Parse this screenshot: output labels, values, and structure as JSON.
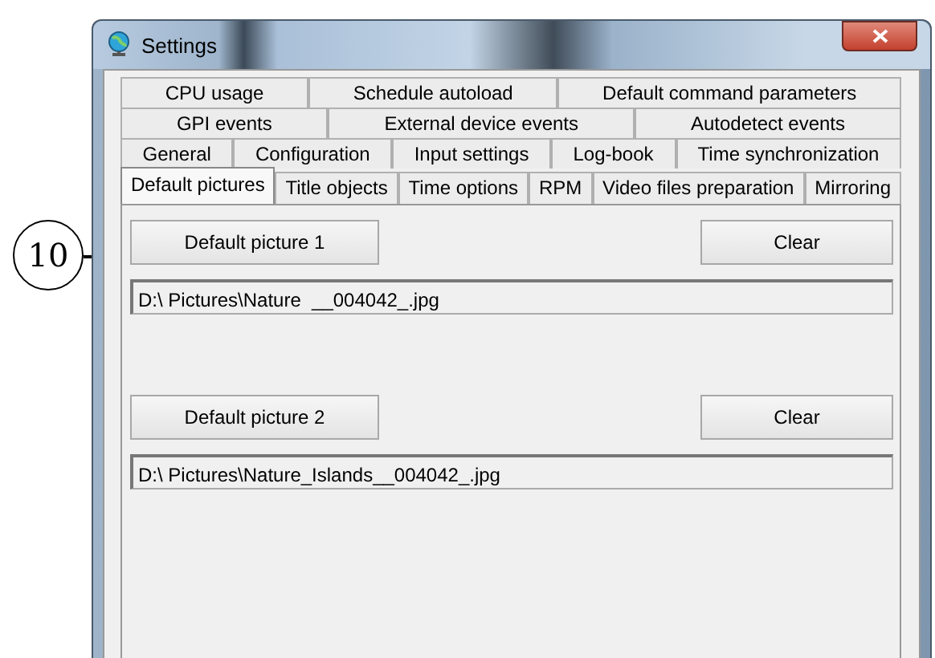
{
  "callout": {
    "label": "10"
  },
  "window": {
    "title": "Settings"
  },
  "tab_rows": [
    {
      "tabs": [
        {
          "label": "CPU usage",
          "selected": false
        },
        {
          "label": "Schedule autoload",
          "selected": false
        },
        {
          "label": "Default command parameters",
          "selected": false
        }
      ]
    },
    {
      "tabs": [
        {
          "label": "GPI events",
          "selected": false
        },
        {
          "label": "External device events",
          "selected": false
        },
        {
          "label": "Autodetect events",
          "selected": false
        }
      ]
    },
    {
      "tabs": [
        {
          "label": "General",
          "selected": false
        },
        {
          "label": "Configuration",
          "selected": false
        },
        {
          "label": "Input settings",
          "selected": false
        },
        {
          "label": "Log-book",
          "selected": false
        },
        {
          "label": "Time synchronization",
          "selected": false
        }
      ]
    },
    {
      "tabs": [
        {
          "label": "Default pictures",
          "selected": true
        },
        {
          "label": "Title objects",
          "selected": false
        },
        {
          "label": "Time options",
          "selected": false
        },
        {
          "label": "RPM",
          "selected": false
        },
        {
          "label": "Video files preparation",
          "selected": false
        },
        {
          "label": "Mirroring",
          "selected": false
        }
      ]
    }
  ],
  "pictures": [
    {
      "button": "Default picture 1",
      "clear": "Clear",
      "path": "D:\\ Pictures\\Nature  __004042_.jpg"
    },
    {
      "button": "Default picture 2",
      "clear": "Clear",
      "path": "D:\\ Pictures\\Nature_Islands__004042_.jpg"
    }
  ]
}
